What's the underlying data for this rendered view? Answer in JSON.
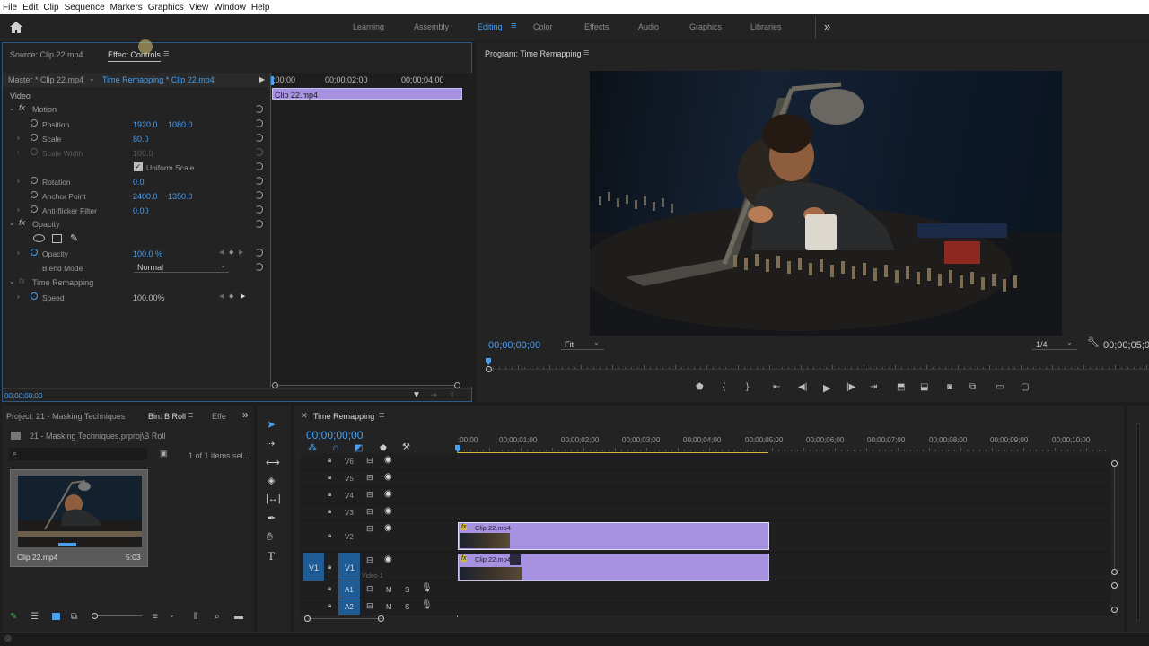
{
  "menu": [
    "File",
    "Edit",
    "Clip",
    "Sequence",
    "Markers",
    "Graphics",
    "View",
    "Window",
    "Help"
  ],
  "workspaces": {
    "tabs": [
      "Learning",
      "Assembly",
      "Editing",
      "Color",
      "Effects",
      "Audio",
      "Graphics",
      "Libraries"
    ],
    "active": "Editing",
    "overflow": "»"
  },
  "source_panel": {
    "tab_source": "Source: Clip 22.mp4",
    "tab_effect_controls": "Effect Controls",
    "master_label": "Master * Clip 22.mp4",
    "sequence_label": "Time Remapping * Clip 22.mp4",
    "timecode_start": ";00;00",
    "timecode_mid": "00;00;02;00",
    "timecode_end": "00;00;04;00",
    "clip_label": "Clip 22.mp4",
    "section_video": "Video",
    "current_time": "00;00;00;00",
    "motion": {
      "label": "Motion",
      "position_label": "Position",
      "position_x": "1920.0",
      "position_y": "1080.0",
      "scale_label": "Scale",
      "scale_value": "80.0",
      "scale_width_label": "Scale Width",
      "scale_width_value": "100.0",
      "uniform_scale_label": "Uniform Scale",
      "rotation_label": "Rotation",
      "rotation_value": "0.0",
      "anchor_label": "Anchor Point",
      "anchor_x": "2400.0",
      "anchor_y": "1350.0",
      "antiflicker_label": "Anti-flicker Filter",
      "antiflicker_value": "0.00"
    },
    "opacity": {
      "label": "Opacity",
      "opacity_label": "Opacity",
      "opacity_value": "100.0 %",
      "blend_label": "Blend Mode",
      "blend_value": "Normal"
    },
    "time_remap": {
      "label": "Time Remapping",
      "speed_label": "Speed",
      "speed_value": "100.00%"
    }
  },
  "program": {
    "title": "Program: Time Remapping",
    "timecode": "00;00;00;00",
    "fit": "Fit",
    "resolution": "1/4",
    "duration": "00;00;05;0"
  },
  "project": {
    "tab_project": "Project: 21 - Masking Techniques",
    "tab_bin": "Bin: B Roll",
    "tab_effects": "Effe",
    "path": "21 - Masking Techniques.prproj\\B Roll",
    "items_selected": "1 of 1 items sel...",
    "clip_name": "Clip 22.mp4",
    "clip_duration": "5:03"
  },
  "timeline": {
    "title": "Time Remapping",
    "timecode": "00;00;00;00",
    "ruler": [
      ":00;00",
      "00;00;01;00",
      "00;00;02;00",
      "00;00;03;00",
      "00;00;04;00",
      "00;00;05;00",
      "00;00;06;00",
      "00;00;07;00",
      "00;00;08;00",
      "00;00;09;00",
      "00;00;10;00"
    ],
    "tracks_video": [
      "V6",
      "V5",
      "V4",
      "V3",
      "V2",
      "V1"
    ],
    "tracks_audio": [
      "A1",
      "A2"
    ],
    "source_v1": "V1",
    "video1_label": "Video 1",
    "mute": "M",
    "solo": "S",
    "clip_v2": "Clip 22.mp4",
    "clip_v1": "Clip 22.mp4",
    "fx": "fx"
  },
  "colors": {
    "accent": "#4a9fef",
    "clip": "#a692e0",
    "panel": "#232323",
    "background": "#1d1d1d"
  }
}
